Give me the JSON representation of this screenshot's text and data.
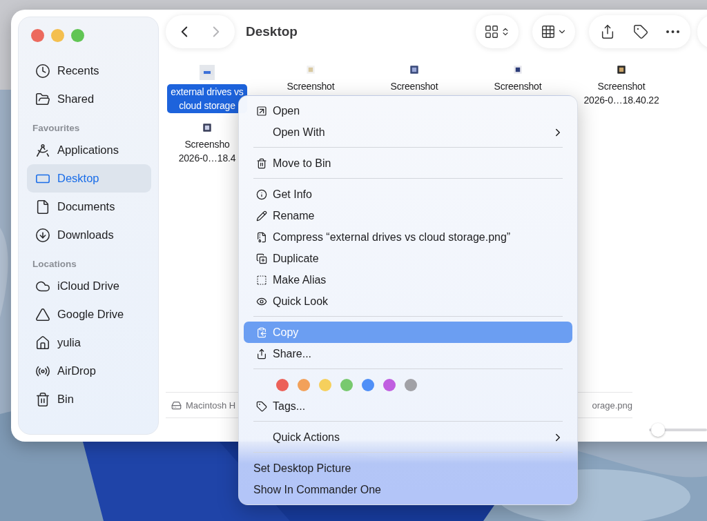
{
  "window": {
    "title": "Desktop",
    "controls": [
      {
        "color": "#ec6a5e"
      },
      {
        "color": "#f4bf4f"
      },
      {
        "color": "#61c554"
      }
    ]
  },
  "toolbar": {
    "back": {
      "disabled": false
    },
    "forward": {
      "disabled": true
    }
  },
  "sidebar": {
    "sections": [
      {
        "items": [
          {
            "label": "Recents",
            "selected": false
          },
          {
            "label": "Shared",
            "selected": false
          }
        ]
      },
      {
        "header": "Favourites",
        "items": [
          {
            "label": "Applications",
            "selected": false
          },
          {
            "label": "Desktop",
            "selected": true
          },
          {
            "label": "Documents",
            "selected": false
          },
          {
            "label": "Downloads",
            "selected": false
          }
        ]
      },
      {
        "header": "Locations",
        "items": [
          {
            "label": "iCloud Drive",
            "selected": false
          },
          {
            "label": "Google Drive",
            "selected": false
          },
          {
            "label": "yulia",
            "selected": false
          },
          {
            "label": "AirDrop",
            "selected": false
          },
          {
            "label": "Bin",
            "selected": false
          }
        ]
      }
    ]
  },
  "files": [
    {
      "lines": [
        "external drives vs",
        "cloud storage"
      ],
      "selected": true
    },
    {
      "lines": [
        "Screenshot"
      ],
      "selected": false
    },
    {
      "lines": [
        "Screenshot"
      ],
      "selected": false
    },
    {
      "lines": [
        "Screenshot"
      ],
      "selected": false
    },
    {
      "lines": [
        "Screenshot",
        "2026-0…18.40.22"
      ],
      "selected": false
    },
    {
      "lines": [
        "Screensho",
        "2026-0…18.4"
      ],
      "selected": false
    }
  ],
  "path_bar": {
    "items": [
      "Macintosh H",
      "orage.png"
    ]
  },
  "icon_size_slider": {
    "level": 0.15
  },
  "context_menu": {
    "sections": [
      {
        "items": [
          {
            "kind": "command",
            "label": "Open",
            "submenu": false,
            "selected": false
          },
          {
            "kind": "command",
            "label": "Open With",
            "submenu": true,
            "selected": false
          }
        ]
      },
      {
        "items": [
          {
            "kind": "command",
            "label": "Move to Bin",
            "submenu": false,
            "selected": false
          }
        ]
      },
      {
        "items": [
          {
            "kind": "command",
            "label": "Get Info",
            "submenu": false,
            "selected": false
          },
          {
            "kind": "command",
            "label": "Rename",
            "submenu": false,
            "selected": false
          },
          {
            "kind": "command",
            "label": "Compress “external drives vs cloud storage.png”",
            "submenu": false,
            "selected": false
          },
          {
            "kind": "command",
            "label": "Duplicate",
            "submenu": false,
            "selected": false
          },
          {
            "kind": "command",
            "label": "Make Alias",
            "submenu": false,
            "selected": false
          },
          {
            "kind": "command",
            "label": "Quick Look",
            "submenu": false,
            "selected": false
          }
        ]
      },
      {
        "items": [
          {
            "kind": "command",
            "label": "Copy",
            "submenu": false,
            "selected": true
          },
          {
            "kind": "command",
            "label": "Share...",
            "submenu": false,
            "selected": false
          }
        ]
      },
      {
        "items": [
          {
            "kind": "tags",
            "colors": [
              {
                "color": "#ec6159"
              },
              {
                "color": "#f2a15a"
              },
              {
                "color": "#f6d05c"
              },
              {
                "color": "#78c96e"
              },
              {
                "color": "#4f8ff7"
              },
              {
                "color": "#c05ee0"
              },
              {
                "color": "#a1a1a6"
              }
            ]
          },
          {
            "kind": "command",
            "label": "Tags...",
            "submenu": false,
            "selected": false
          }
        ]
      },
      {
        "items": [
          {
            "kind": "command",
            "label": "Quick Actions",
            "submenu": true,
            "selected": false
          }
        ]
      },
      {
        "items": [
          {
            "kind": "plain",
            "label": "Set Desktop Picture",
            "submenu": false,
            "selected": false
          },
          {
            "kind": "plain",
            "label": "Show In Commander One",
            "submenu": false,
            "selected": false
          }
        ]
      }
    ]
  }
}
